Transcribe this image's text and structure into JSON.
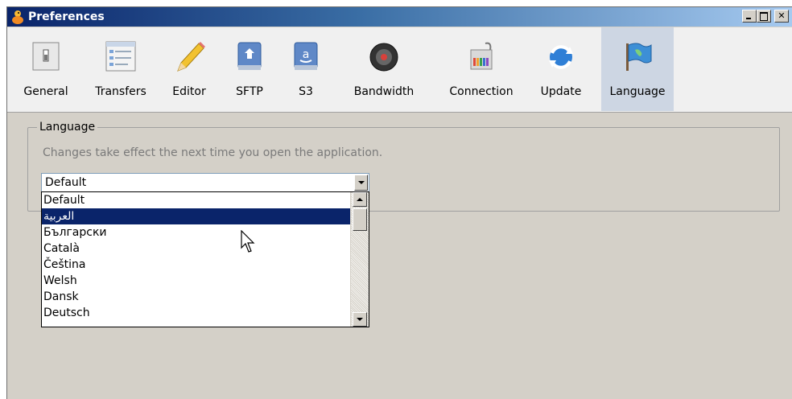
{
  "window": {
    "title": "Preferences"
  },
  "toolbar": {
    "items": [
      {
        "label": "General",
        "icon": "general-switch-icon"
      },
      {
        "label": "Transfers",
        "icon": "transfers-list-icon"
      },
      {
        "label": "Editor",
        "icon": "pencil-icon"
      },
      {
        "label": "SFTP",
        "icon": "sftp-drive-icon"
      },
      {
        "label": "S3",
        "icon": "s3-drive-icon"
      },
      {
        "label": "Bandwidth",
        "icon": "speaker-dial-icon"
      },
      {
        "label": "Connection",
        "icon": "network-plug-icon"
      },
      {
        "label": "Update",
        "icon": "refresh-globe-icon"
      },
      {
        "label": "Language",
        "icon": "flag-icon"
      }
    ],
    "selected": "Language"
  },
  "language": {
    "group_label": "Language",
    "hint": "Changes take effect the next time you open the application.",
    "current_value": "Default",
    "options": [
      "Default",
      "العربية",
      "Български",
      "Català",
      "Čeština",
      "Welsh",
      "Dansk",
      "Deutsch"
    ],
    "highlighted_option": "العربية"
  },
  "colors": {
    "title_bar_start": "#0a246a",
    "title_bar_end": "#a6caf0",
    "selection": "#0a246a",
    "window_background": "#d4d0c8"
  }
}
